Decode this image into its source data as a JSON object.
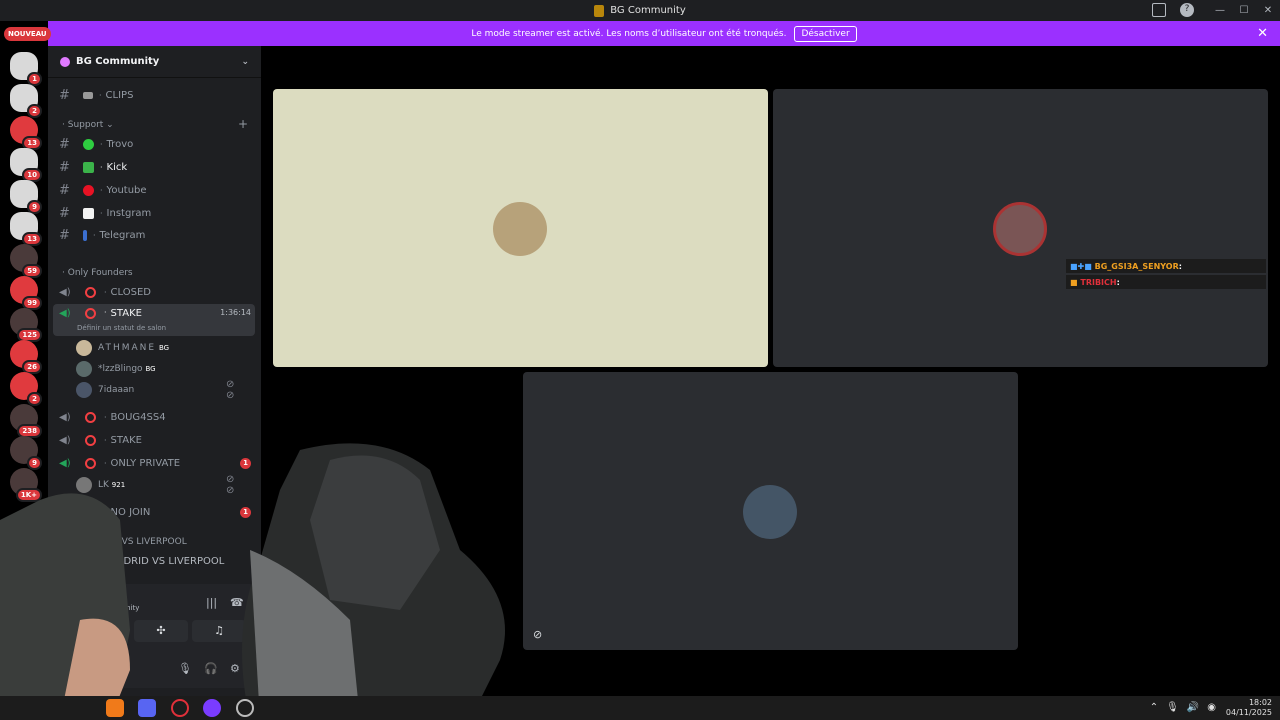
{
  "window": {
    "title": "BG Community",
    "min": "—",
    "max": "☐",
    "close": "✕"
  },
  "banner": {
    "text": "Le mode streamer est activé. Les noms d’utilisateur ont été tronqués.",
    "button": "Désactiver",
    "close": "✕"
  },
  "rail": {
    "nouveau": "NOUVEAU",
    "servers": [
      {
        "badge": "1"
      },
      {
        "badge": "2"
      },
      {
        "badge": "13"
      },
      {
        "badge": "10"
      },
      {
        "badge": "9"
      },
      {
        "badge": "13"
      },
      {
        "badge": "59"
      },
      {
        "badge": "99"
      },
      {
        "badge": "125"
      },
      {
        "badge": "26"
      },
      {
        "badge": "2"
      },
      {
        "badge": "238"
      },
      {
        "badge": "9"
      },
      {
        "badge": "1K+"
      }
    ]
  },
  "sidebar": {
    "server_name": "BG Community",
    "channels": {
      "clips": "CLIPS",
      "support_category": "Support",
      "trovo": "Trovo",
      "kick": "Kick",
      "youtube": "Youtube",
      "instgram": "Instgram",
      "telegram": "Telegram",
      "founders_category": "Only Founders",
      "closed": "CLOSED",
      "stake": "STAKE",
      "stake_time": "1:36:14",
      "stake_status": "Définir un statut de salon",
      "boug": "BOUG4SS4",
      "stake2": "STAKE",
      "only_private": "ONLY PRIVATE",
      "only_private_badge": "1",
      "no_join": "NO JOIN",
      "no_join_badge": "1",
      "madrid_category": "DRID VS LIVERPOOL",
      "madrid": "MADRID VS LIVERPOOL"
    },
    "users": [
      {
        "name": "ATHMANE",
        "tag": "BG"
      },
      {
        "name": "*lzzBlingo",
        "tag": "BG"
      },
      {
        "name": "7idaaan",
        "tag": ""
      },
      {
        "name": "LK",
        "tag": "921"
      }
    ],
    "voice_panel": {
      "label": "mmunity",
      "sub": "al"
    }
  },
  "chat": [
    {
      "user": "BG_GSI3A_SENYOR",
      "sep": ":"
    },
    {
      "user": "TRIBICH",
      "sep": ":"
    }
  ],
  "taskbar": {
    "time": "18:02",
    "date": "04/11/2025"
  },
  "colors": {
    "accent": "#9b30ff",
    "danger": "#da373c",
    "tile_cream": "#dcdcc0",
    "tile_dark": "#2b2d31"
  }
}
